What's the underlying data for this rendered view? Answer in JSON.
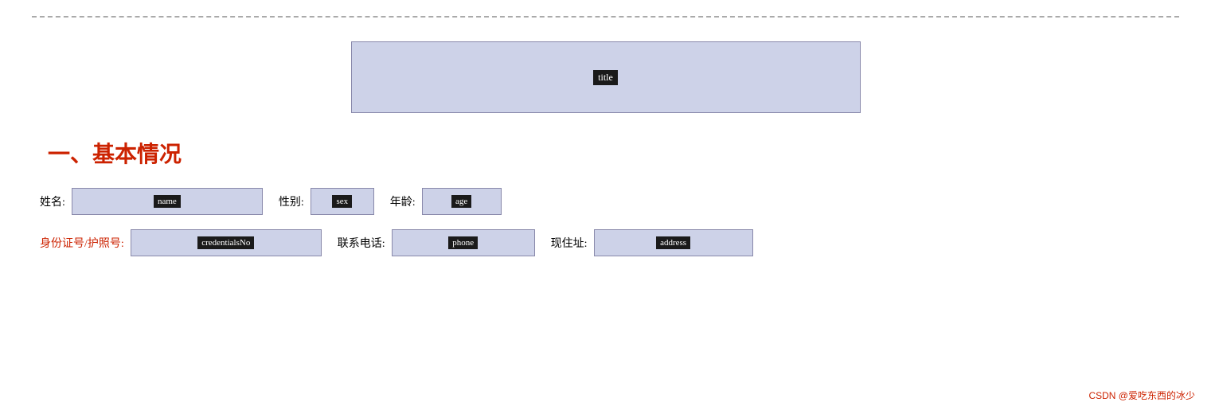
{
  "top": {
    "border_style": "dashed"
  },
  "title": {
    "label": "title",
    "placeholder": "title"
  },
  "section1": {
    "heading": "一、基本情况"
  },
  "row1": {
    "name_label": "姓名:",
    "name_placeholder": "name",
    "sex_label": "性别:",
    "sex_placeholder": "sex",
    "age_label": "年龄:",
    "age_placeholder": "age"
  },
  "row2": {
    "credentials_label": "身份证号/护照号:",
    "credentials_placeholder": "credentialsNo",
    "phone_label": "联系电话:",
    "phone_placeholder": "phone",
    "address_label": "现住址:",
    "address_placeholder": "address"
  },
  "watermark": {
    "text": "CSDN @爱吃东西的冰少"
  }
}
